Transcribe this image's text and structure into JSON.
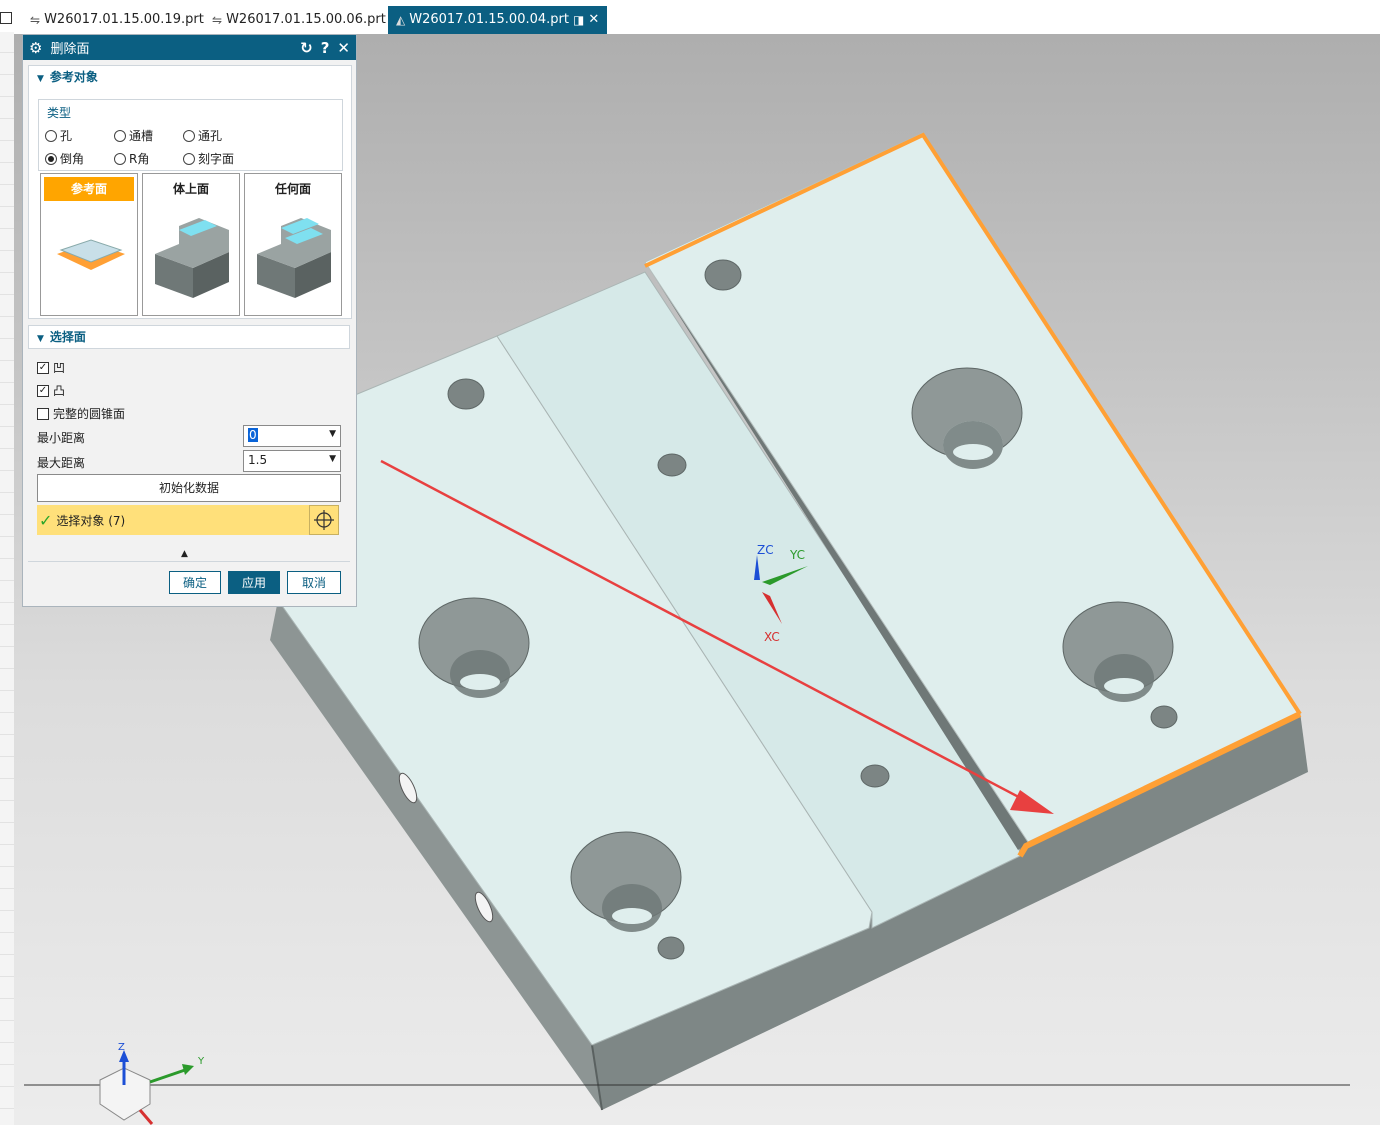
{
  "tabs": [
    {
      "name": "W26017.01.15.00.19.prt",
      "icon": "assembly-icon"
    },
    {
      "name": "W26017.01.15.00.06.prt",
      "icon": "assembly-icon"
    },
    {
      "name": "W26017.01.15.00.04.prt",
      "icon": "part-icon",
      "active": true
    }
  ],
  "dialog": {
    "title": "删除面",
    "reference": {
      "header": "参考对象",
      "type_label": "类型",
      "radios": [
        "孔",
        "通槽",
        "通孔",
        "倒角",
        "R角",
        "刻字面"
      ],
      "selected_radio": "倒角",
      "cards": [
        "参考面",
        "体上面",
        "任何面"
      ],
      "selected_card": "参考面"
    },
    "select_face": {
      "header": "选择面",
      "checkboxes": [
        {
          "label": "凹",
          "checked": true
        },
        {
          "label": "凸",
          "checked": true
        },
        {
          "label": "完整的圆锥面",
          "checked": false
        }
      ],
      "min_label": "最小距离",
      "min_value": "0",
      "max_label": "最大距离",
      "max_value": "1.5",
      "init_button": "初始化数据",
      "select_object": "选择对象 (7)"
    },
    "ok": "确定",
    "apply": "应用",
    "cancel": "取消"
  },
  "triad": {
    "zc": "ZC",
    "yc": "YC",
    "xc": "XC"
  },
  "view_triad": {
    "z": "Z",
    "y": "Y"
  },
  "colors": {
    "accent": "#0b5f82",
    "highlight": "#ffa500",
    "face": "#deefee",
    "side": "#838c8b",
    "arrow": "#e84040"
  }
}
